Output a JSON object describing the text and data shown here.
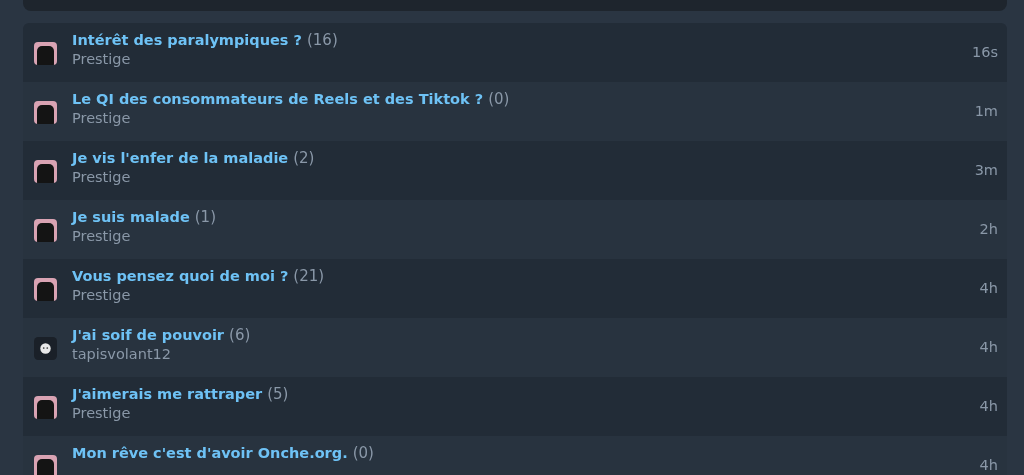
{
  "topics": [
    {
      "title": "Intérêt des paralympiques ?",
      "count": "(16)",
      "author": "Prestige",
      "time": "16s",
      "kind": "photo"
    },
    {
      "title": "Le QI des consommateurs de Reels et des Tiktok ?",
      "count": "(0)",
      "author": "Prestige",
      "time": "1m",
      "kind": "photo"
    },
    {
      "title": "Je vis l'enfer de la maladie",
      "count": "(2)",
      "author": "Prestige",
      "time": "3m",
      "kind": "photo"
    },
    {
      "title": "Je suis malade",
      "count": "(1)",
      "author": "Prestige",
      "time": "2h",
      "kind": "photo"
    },
    {
      "title": "Vous pensez quoi de moi ?",
      "count": "(21)",
      "author": "Prestige",
      "time": "4h",
      "kind": "photo"
    },
    {
      "title": "J'ai soif de pouvoir",
      "count": "(6)",
      "author": "tapisvolant12",
      "time": "4h",
      "kind": "icon"
    },
    {
      "title": "J'aimerais me rattraper",
      "count": "(5)",
      "author": "Prestige",
      "time": "4h",
      "kind": "photo"
    },
    {
      "title": "Mon rêve c'est d'avoir Onche.org.",
      "count": "(0)",
      "time": "4h",
      "kind": "photo"
    }
  ]
}
